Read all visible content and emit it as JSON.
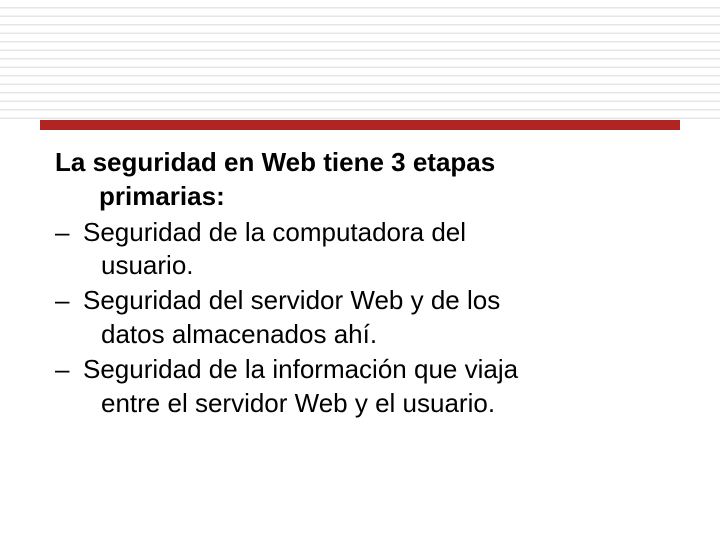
{
  "heading": {
    "line1": "La seguridad en Web tiene 3 etapas",
    "line2": "primarias:"
  },
  "items": [
    {
      "l1": "Seguridad de la computadora del",
      "l2": "usuario."
    },
    {
      "l1": "Seguridad del servidor Web y de los",
      "l2": "datos almacenados ahí."
    },
    {
      "l1": "Seguridad de la información que viaja",
      "l2": "entre el servidor Web y el usuario."
    }
  ],
  "dash": "–"
}
